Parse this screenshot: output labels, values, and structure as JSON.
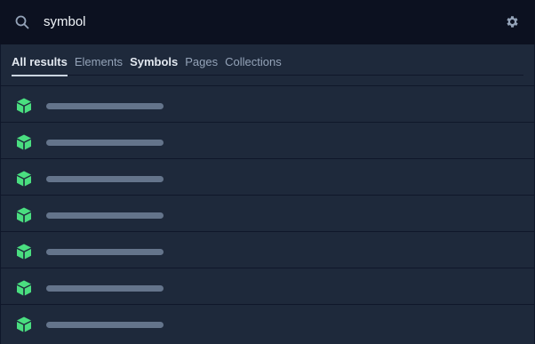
{
  "search": {
    "value": "symbol",
    "icon": "search-icon"
  },
  "settings": {
    "icon": "gear-icon"
  },
  "tabs": [
    {
      "label": "All results",
      "active": true,
      "bold": true
    },
    {
      "label": "Elements",
      "active": false,
      "bold": false
    },
    {
      "label": "Symbols",
      "active": false,
      "bold": true
    },
    {
      "label": "Pages",
      "active": false,
      "bold": false
    },
    {
      "label": "Collections",
      "active": false,
      "bold": false
    }
  ],
  "results": {
    "count": 7,
    "item_icon": "cube-icon",
    "item_icon_color": "#4ade80",
    "placeholder_color": "#64748b"
  },
  "colors": {
    "background": "#0c1120",
    "panel": "#1e293b",
    "accent": "#4ade80"
  }
}
